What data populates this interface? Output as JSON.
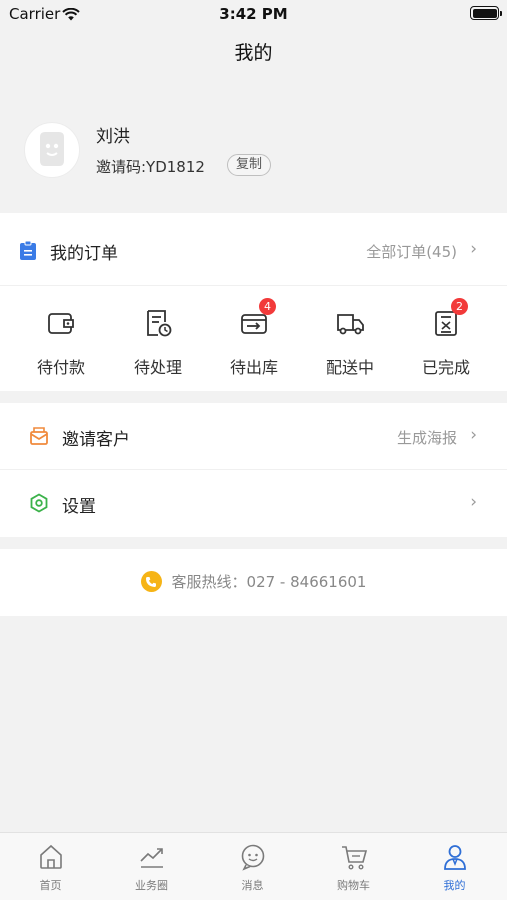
{
  "status_bar": {
    "carrier": "Carrier",
    "time": "3:42 PM"
  },
  "nav": {
    "title": "我的"
  },
  "profile": {
    "name": "刘洪",
    "invite_code": "邀请码:YD1812",
    "copy_label": "复制"
  },
  "orders": {
    "title": "我的订单",
    "all_label": "全部订单(45)",
    "items": [
      {
        "label": "待付款",
        "icon": "wallet-icon"
      },
      {
        "label": "待处理",
        "icon": "document-clock-icon"
      },
      {
        "label": "待出库",
        "icon": "warehouse-out-icon",
        "badge": "4"
      },
      {
        "label": "配送中",
        "icon": "delivery-truck-icon"
      },
      {
        "label": "已完成",
        "icon": "completed-clipboard-icon",
        "badge": "2"
      }
    ]
  },
  "menu": {
    "invite": {
      "label": "邀请客户",
      "right": "生成海报",
      "icon": "envelope-icon"
    },
    "settings": {
      "label": "设置",
      "icon": "hexagon-gear-icon"
    }
  },
  "hotline": {
    "text": "客服热线：027 - 84661601"
  },
  "tabs": [
    {
      "label": "首页",
      "icon": "home-icon"
    },
    {
      "label": "业务圈",
      "icon": "trend-chart-icon"
    },
    {
      "label": "消息",
      "icon": "chat-bubble-icon"
    },
    {
      "label": "购物车",
      "icon": "cart-icon"
    },
    {
      "label": "我的",
      "icon": "user-icon",
      "active": true
    }
  ],
  "colors": {
    "accent": "#2f6fd6",
    "badge": "#f23a3a",
    "orders_icon": "#3a7be6",
    "invite_icon": "#f08a3c",
    "settings_icon": "#3bb24a",
    "hotline_icon": "#f6b416"
  }
}
